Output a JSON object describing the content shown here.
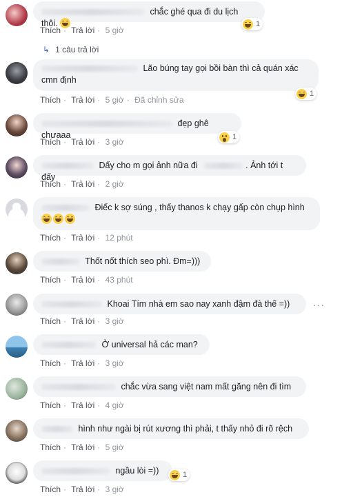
{
  "colors": {
    "bubble_bg": "#f2f3f5",
    "link": "#4b4f56",
    "meta": "#90949c",
    "reaction": "#fbd04b",
    "reply_icon": "#4267b2"
  },
  "actions": {
    "like": "Thích",
    "reply": "Trả lời"
  },
  "comments": [
    {
      "text": "chắc ghé qua đi du lịch thôi.",
      "time": "5 giờ",
      "reaction_count": "1",
      "reaction_icon": "haha-emoji-icon",
      "inline_emoji": "haha-emoji-icon"
    },
    {
      "text": "Lão búng tay gọi bồi bàn thì cả quán xác cmn định",
      "time": "5 giờ",
      "edited": "Đã chỉnh sửa",
      "reaction_count": "1",
      "reaction_icon": "haha-emoji-icon"
    },
    {
      "text": "đẹp ghê chưaaa",
      "time": "3 giờ",
      "reaction_count": "1",
      "reaction_icon": "wow-emoji-icon"
    },
    {
      "text": "Dấy cho m gọi ảnh nữa đi",
      "text2": ". Ảnh tới t đấy",
      "time": "2 giờ"
    },
    {
      "text": "Điếc k sợ súng , thấy thanos k chạy gấp còn chụp hình",
      "time": "12 phút",
      "inline_emoji": "haha-emoji-icon"
    },
    {
      "text": "Thốt nốt thích seo phì. Đm=)))",
      "time": "43 phút"
    },
    {
      "text": "Khoai Tím nhà em sao nay xanh đậm đà thế =))",
      "time": "3 giờ"
    },
    {
      "text": "Ở universal hả các man?",
      "time": "3 giờ"
    },
    {
      "text": "chắc vừa sang việt nam mất găng nên đi tìm",
      "time": "4 giờ"
    },
    {
      "text": "hình như ngài bị rút xương thì phải, t thấy nhỏ đi rõ rệch",
      "time": "5 giờ"
    },
    {
      "text": "ngầu lòi =))",
      "time": "3 giờ",
      "reaction_count": "1",
      "reaction_icon": "haha-emoji-icon"
    }
  ],
  "reply_summary": "1 câu trả lời",
  "more_options": "···"
}
